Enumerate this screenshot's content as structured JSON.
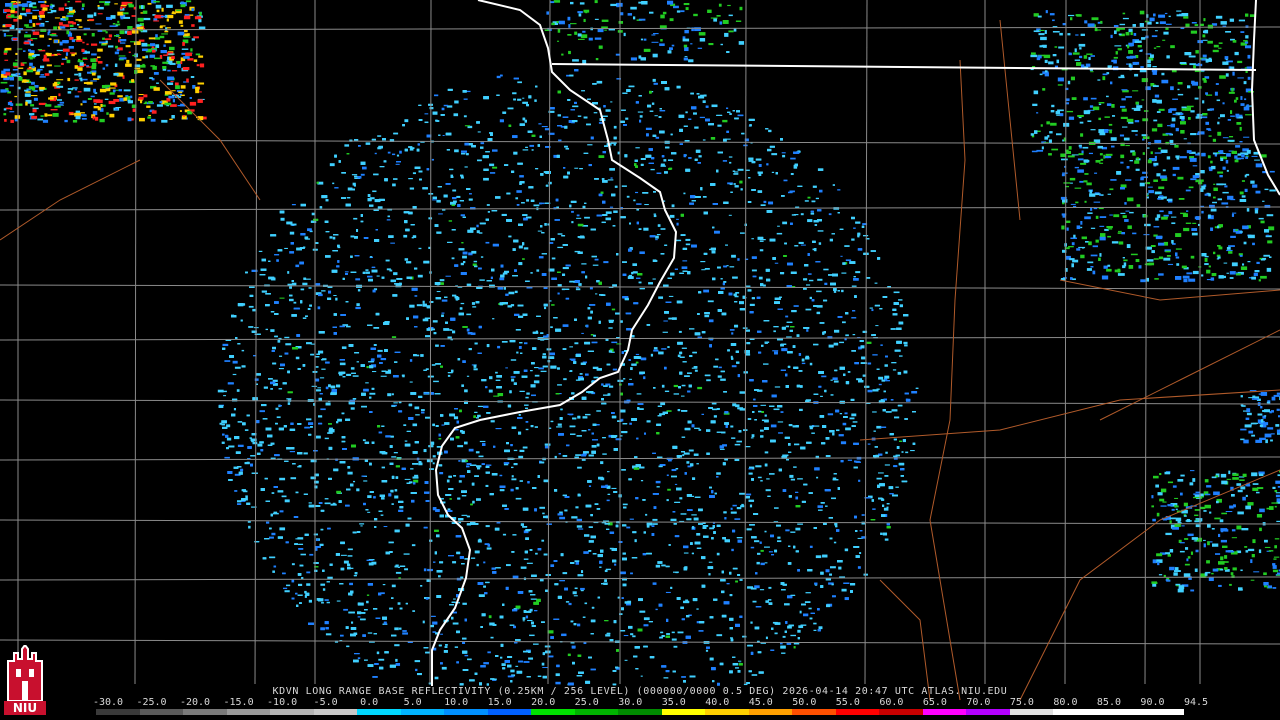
{
  "product": {
    "caption": "KDVN LONG RANGE BASE REFLECTIVITY (0.25KM / 256 LEVEL) (000000/0000 0.5 DEG) 2026-04-14 20:47 UTC  ATLAS.NIU.EDU"
  },
  "scale": {
    "labels": [
      "-30.0",
      "-25.0",
      "-20.0",
      "-15.0",
      "-10.0",
      "-5.0",
      "0.0",
      "5.0",
      "10.0",
      "15.0",
      "20.0",
      "25.0",
      "30.0",
      "35.0",
      "40.0",
      "45.0",
      "50.0",
      "55.0",
      "60.0",
      "65.0",
      "70.0",
      "75.0",
      "80.0",
      "85.0",
      "90.0",
      "94.5"
    ],
    "colors": [
      "#3a3a3a",
      "#5a5a5a",
      "#7a7a7a",
      "#9a9a9a",
      "#b4b4b4",
      "#c8c8c8",
      "#00d8ff",
      "#00b4ff",
      "#0090ff",
      "#0060ff",
      "#00e000",
      "#00b400",
      "#008c00",
      "#ffff00",
      "#ffd000",
      "#ffa000",
      "#ff5000",
      "#ff0000",
      "#c80000",
      "#ff00ff",
      "#b400ff",
      "#e0e0e0",
      "#ffffff",
      "#ffffff",
      "#ffffff"
    ]
  },
  "logo": {
    "text": "NIU",
    "colors": {
      "primary": "#c8102e",
      "secondary": "#ffffff"
    }
  },
  "map": {
    "radar_site": "KDVN",
    "colors": {
      "background": "#000000",
      "state_border": "#ffffff",
      "county_border": "#8a8a8a",
      "highway": "#b05a2a",
      "echo_light": "#40d0ff",
      "echo_mid": "#1f80ff",
      "echo_green": "#22cc22",
      "echo_yellow": "#ffd000",
      "echo_red": "#ff2020"
    }
  }
}
